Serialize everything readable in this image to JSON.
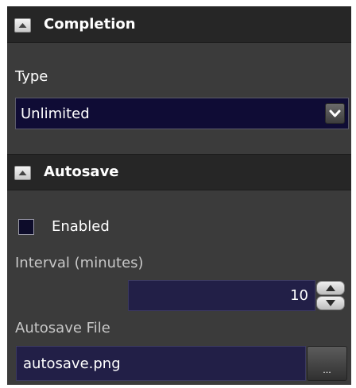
{
  "completion": {
    "header": {
      "title": "Completion",
      "collapse_icon": "triangle-up-icon"
    },
    "type_label": "Type",
    "type_select": {
      "value": "Unlimited",
      "arrow_icon": "chevron-down-icon"
    }
  },
  "autosave": {
    "header": {
      "title": "Autosave",
      "collapse_icon": "triangle-up-icon"
    },
    "enabled": {
      "label": "Enabled",
      "checked": false
    },
    "interval_label": "Interval (minutes)",
    "interval_value": "10",
    "spinner_icons": [
      "triangle-up-icon",
      "triangle-down-icon"
    ],
    "file_label": "Autosave File",
    "file_value": "autosave.png",
    "browse_label": "..."
  },
  "colors": {
    "panel_bg": "#3b3b3b",
    "header_bg": "#262626",
    "field_bg": "#221f47",
    "select_bg": "#0f0c35"
  }
}
